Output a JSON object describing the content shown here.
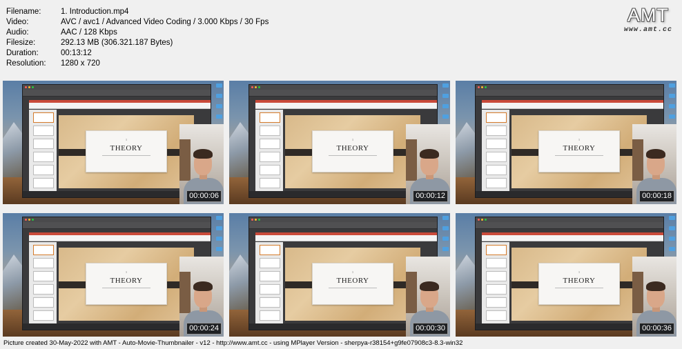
{
  "file_info": {
    "rows": [
      {
        "key": "Filename:",
        "value": "1. Introduction.mp4"
      },
      {
        "key": "Video:",
        "value": "AVC / avc1 / Advanced Video Coding / 3.000 Kbps / 30 Fps"
      },
      {
        "key": "Audio:",
        "value": "AAC / 128 Kbps"
      },
      {
        "key": "Filesize:",
        "value": "292.13 MB (306.321.187 Bytes)"
      },
      {
        "key": "Duration:",
        "value": "00:13:12"
      },
      {
        "key": "Resolution:",
        "value": "1280 x 720"
      }
    ]
  },
  "logo": {
    "mark": "AMT",
    "url": "www.amt.cc"
  },
  "thumbnails": [
    {
      "slide_number": "1",
      "slide_title": "THEORY",
      "timestamp": "00:00:06"
    },
    {
      "slide_number": "1",
      "slide_title": "THEORY",
      "timestamp": "00:00:12"
    },
    {
      "slide_number": "1",
      "slide_title": "THEORY",
      "timestamp": "00:00:18"
    },
    {
      "slide_number": "1",
      "slide_title": "THEORY",
      "timestamp": "00:00:24"
    },
    {
      "slide_number": "1",
      "slide_title": "THEORY",
      "timestamp": "00:00:30"
    },
    {
      "slide_number": "1",
      "slide_title": "THEORY",
      "timestamp": "00:00:36"
    }
  ],
  "footer": {
    "text": "Picture created 30-May-2022 with AMT - Auto-Movie-Thumbnailer - v12 - http://www.amt.cc - using MPlayer Version - sherpya-r38154+g9fe07908c3-8.3-win32"
  }
}
